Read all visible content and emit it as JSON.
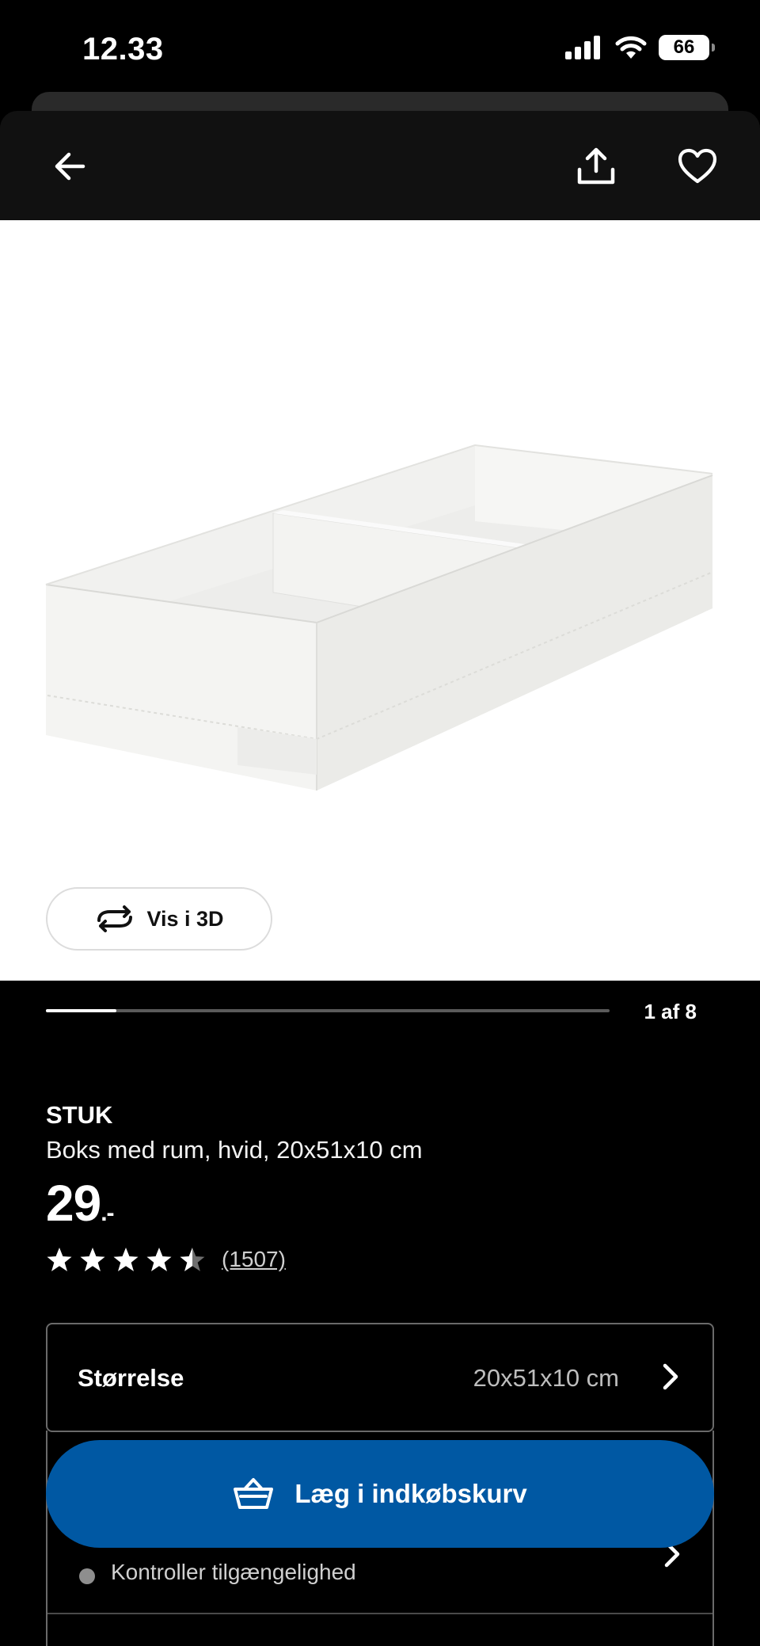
{
  "status_bar": {
    "time": "12.33",
    "battery": "66",
    "icons": [
      "signal-icon",
      "wifi-icon",
      "battery-icon"
    ]
  },
  "header": {
    "icons": [
      "back-arrow-icon",
      "share-icon",
      "heart-icon"
    ]
  },
  "gallery": {
    "view_3d_label": "Vis i 3D",
    "counter": "1 af 8",
    "progress": 0.125
  },
  "product": {
    "name": "STUK",
    "description": "Boks med rum, hvid, 20x51x10 cm",
    "price": "29",
    "price_suffix": ".-",
    "rating": 4.5,
    "rating_max": 5,
    "review_count": "(1507)"
  },
  "size": {
    "label": "Størrelse",
    "value": "20x51x10 cm"
  },
  "availability": {
    "text": "Kontroller tilgængelighed"
  },
  "cart": {
    "label": "Læg i indkøbskurv"
  },
  "colors": {
    "accent": "#0058a3",
    "background": "#111111",
    "status_dot": "#8e8e8e"
  }
}
